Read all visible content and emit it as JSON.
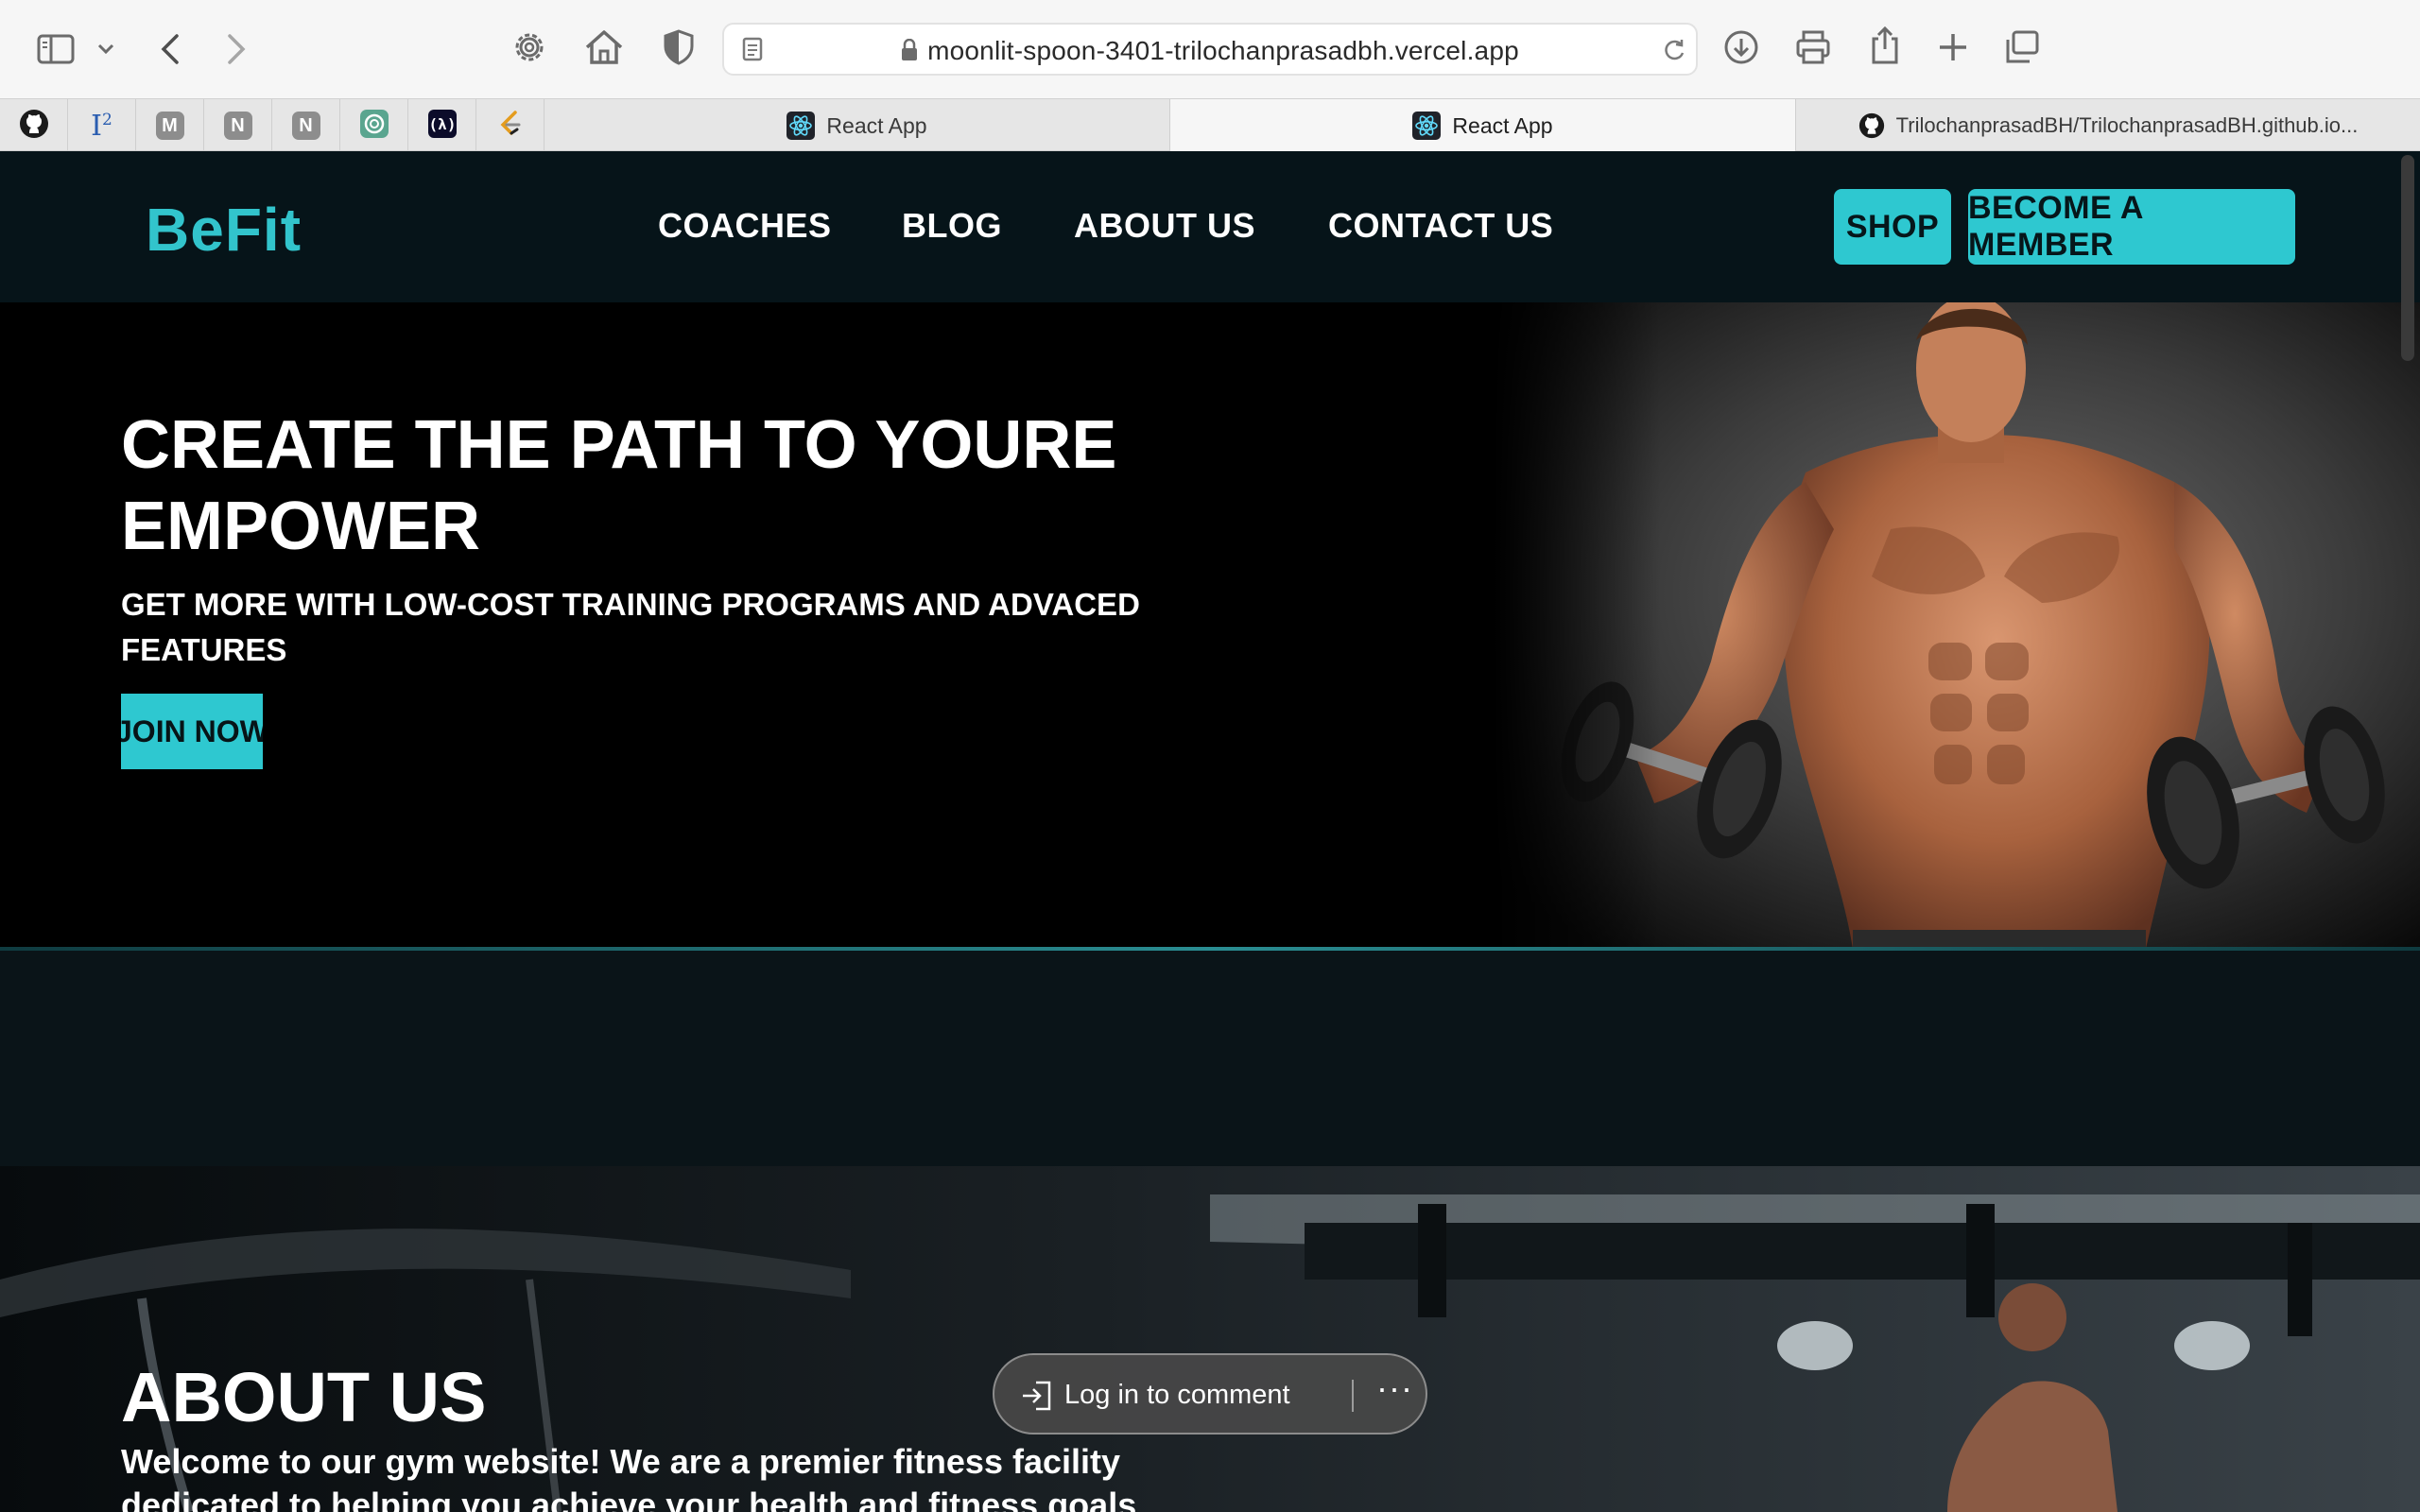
{
  "browser": {
    "url": "moonlit-spoon-3401-trilochanprasadbh.vercel.app",
    "pinned_tabs": [
      {
        "icon": "github-icon"
      },
      {
        "icon": "i-squared-icon",
        "label": "I",
        "sup": "2"
      },
      {
        "icon": "m-letter-icon",
        "label": "M"
      },
      {
        "icon": "n-letter-icon",
        "label": "N"
      },
      {
        "icon": "n-letter-icon",
        "label": "N"
      },
      {
        "icon": "chatgpt-icon"
      },
      {
        "icon": "code-bracket-icon"
      },
      {
        "icon": "leetcode-icon"
      }
    ],
    "tabs": [
      {
        "title": "React App",
        "active": false,
        "icon": "react-icon"
      },
      {
        "title": "React App",
        "active": true,
        "icon": "react-icon"
      },
      {
        "title": "TrilochanprasadBH/TrilochanprasadBH.github.io...",
        "active": false,
        "icon": "github-icon"
      }
    ]
  },
  "site": {
    "logo": "BeFit",
    "nav": [
      "COACHES",
      "BLOG",
      "ABOUT US",
      "CONTACT US"
    ],
    "shop_label": "SHOP",
    "member_label": "BECOME A MEMBER",
    "accent": "#2ec8d0",
    "hero": {
      "title": "CREATE THE PATH TO YOURE EMPOWER",
      "subtitle": "GET MORE WITH LOW-COST TRAINING PROGRAMS AND ADVACED FEATURES",
      "cta": "JOIN NOW"
    },
    "about": {
      "title": "ABOUT US",
      "text": "Welcome to our gym website! We are a premier fitness facility dedicated to helping you achieve your health and fitness goals"
    }
  },
  "overlay": {
    "comment_label": "Log in to comment",
    "more_label": "···"
  }
}
